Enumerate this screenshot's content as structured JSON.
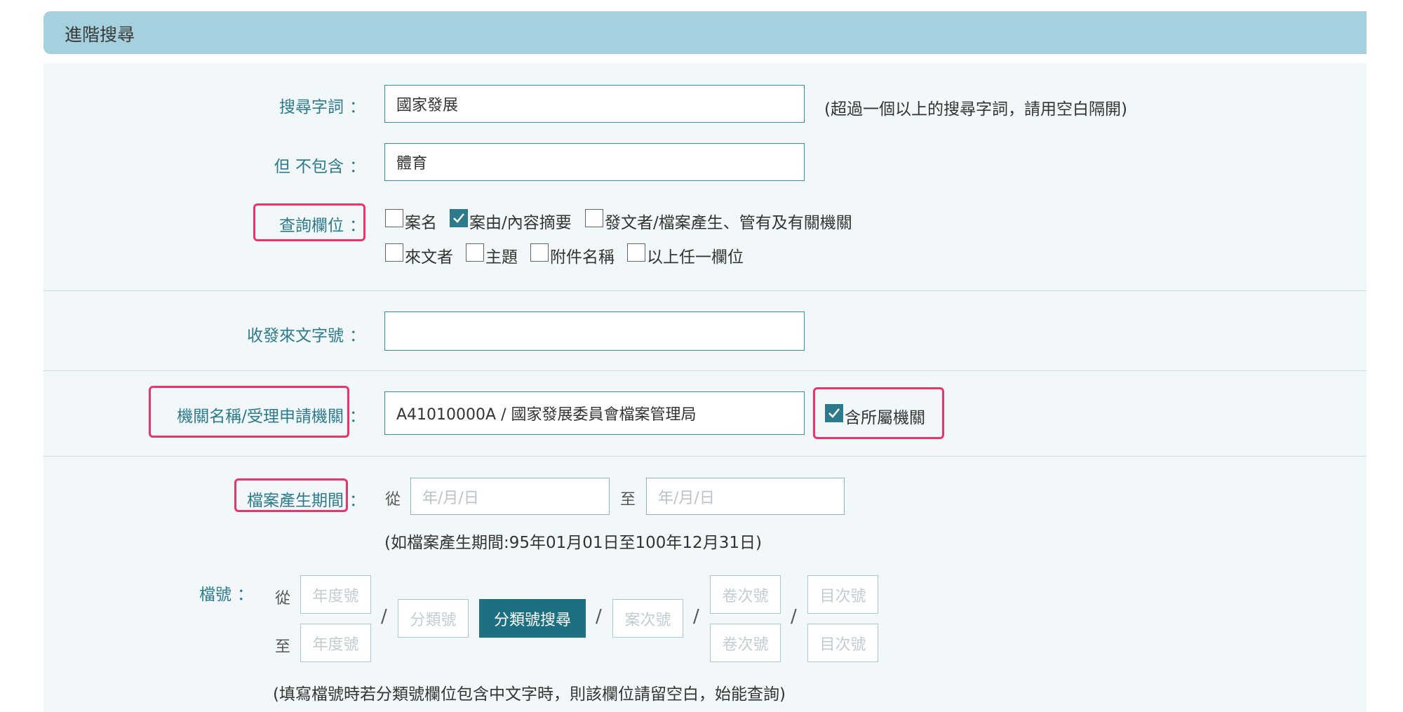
{
  "header": {
    "title": "進階搜尋"
  },
  "keyword": {
    "label": "搜尋字詞",
    "value": "國家發展",
    "hint": "(超過一個以上的搜尋字詞，請用空白隔開)"
  },
  "exclude": {
    "label": "但 不包含",
    "value": "體育"
  },
  "fields": {
    "label": "查詢欄位",
    "options": [
      {
        "label": "案名",
        "checked": false
      },
      {
        "label": "案由/內容摘要",
        "checked": true
      },
      {
        "label": "發文者/檔案產生、管有及有關機關",
        "checked": false
      },
      {
        "label": "來文者",
        "checked": false
      },
      {
        "label": "主題",
        "checked": false
      },
      {
        "label": "附件名稱",
        "checked": false
      },
      {
        "label": "以上任一欄位",
        "checked": false
      }
    ]
  },
  "doc_number": {
    "label": "收發來文字號",
    "value": ""
  },
  "agency": {
    "label": "機關名稱/受理申請機關",
    "value": "A41010000A / 國家發展委員會檔案管理局",
    "include_sub_label": "含所屬機關",
    "include_sub_checked": true
  },
  "period": {
    "label": "檔案產生期間",
    "from_label": "從",
    "to_label": "至",
    "from_placeholder": "年/月/日",
    "to_placeholder": "年/月/日",
    "hint": "(如檔案產生期間:95年01月01日至100年12月31日)"
  },
  "file_no": {
    "label": "檔號",
    "from_label": "從",
    "to_label": "至",
    "year_placeholder": "年度號",
    "class_placeholder": "分類號",
    "search_button": "分類號搜尋",
    "case_placeholder": "案次號",
    "volume_placeholder": "卷次號",
    "item_placeholder": "目次號",
    "hint": "(填寫檔號時若分類號欄位包含中文字時，則該欄位請留空白，始能查詢)"
  },
  "colon": "："
}
